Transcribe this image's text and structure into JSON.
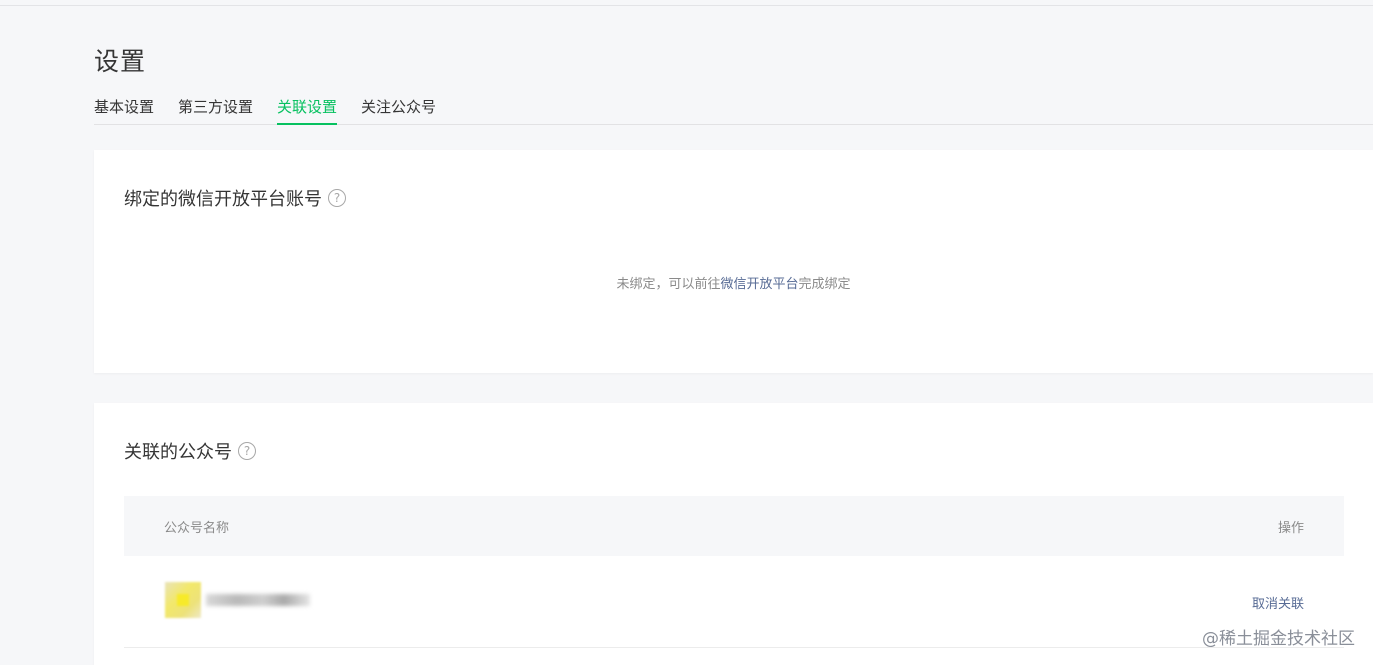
{
  "page": {
    "title": "设置"
  },
  "tabs": [
    {
      "label": "基本设置",
      "active": false
    },
    {
      "label": "第三方设置",
      "active": false
    },
    {
      "label": "关联设置",
      "active": true
    },
    {
      "label": "关注公众号",
      "active": false
    }
  ],
  "open_platform": {
    "title": "绑定的微信开放平台账号",
    "help_icon": "question-circle-icon",
    "empty_prefix": "未绑定，可以前往",
    "empty_link": "微信开放平台",
    "empty_suffix": "完成绑定"
  },
  "linked_accounts": {
    "title": "关联的公众号",
    "help_icon": "question-circle-icon",
    "columns": {
      "name": "公众号名称",
      "ops": "操作"
    },
    "rows": [
      {
        "name": "",
        "action": "取消关联"
      }
    ]
  },
  "watermark": "@稀土掘金技术社区",
  "colors": {
    "accent": "#07c160",
    "link": "#576b95",
    "bg": "#f6f7f9"
  }
}
